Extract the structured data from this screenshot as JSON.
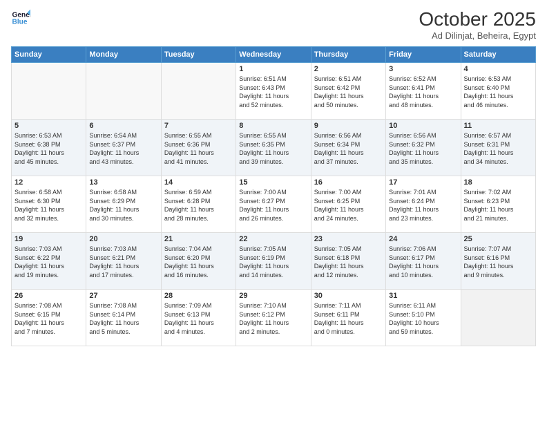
{
  "header": {
    "logo_line1": "General",
    "logo_line2": "Blue",
    "title": "October 2025",
    "location": "Ad Dilinjat, Beheira, Egypt"
  },
  "days_of_week": [
    "Sunday",
    "Monday",
    "Tuesday",
    "Wednesday",
    "Thursday",
    "Friday",
    "Saturday"
  ],
  "weeks": [
    [
      {
        "day": "",
        "content": ""
      },
      {
        "day": "",
        "content": ""
      },
      {
        "day": "",
        "content": ""
      },
      {
        "day": "1",
        "content": "Sunrise: 6:51 AM\nSunset: 6:43 PM\nDaylight: 11 hours\nand 52 minutes."
      },
      {
        "day": "2",
        "content": "Sunrise: 6:51 AM\nSunset: 6:42 PM\nDaylight: 11 hours\nand 50 minutes."
      },
      {
        "day": "3",
        "content": "Sunrise: 6:52 AM\nSunset: 6:41 PM\nDaylight: 11 hours\nand 48 minutes."
      },
      {
        "day": "4",
        "content": "Sunrise: 6:53 AM\nSunset: 6:40 PM\nDaylight: 11 hours\nand 46 minutes."
      }
    ],
    [
      {
        "day": "5",
        "content": "Sunrise: 6:53 AM\nSunset: 6:38 PM\nDaylight: 11 hours\nand 45 minutes."
      },
      {
        "day": "6",
        "content": "Sunrise: 6:54 AM\nSunset: 6:37 PM\nDaylight: 11 hours\nand 43 minutes."
      },
      {
        "day": "7",
        "content": "Sunrise: 6:55 AM\nSunset: 6:36 PM\nDaylight: 11 hours\nand 41 minutes."
      },
      {
        "day": "8",
        "content": "Sunrise: 6:55 AM\nSunset: 6:35 PM\nDaylight: 11 hours\nand 39 minutes."
      },
      {
        "day": "9",
        "content": "Sunrise: 6:56 AM\nSunset: 6:34 PM\nDaylight: 11 hours\nand 37 minutes."
      },
      {
        "day": "10",
        "content": "Sunrise: 6:56 AM\nSunset: 6:32 PM\nDaylight: 11 hours\nand 35 minutes."
      },
      {
        "day": "11",
        "content": "Sunrise: 6:57 AM\nSunset: 6:31 PM\nDaylight: 11 hours\nand 34 minutes."
      }
    ],
    [
      {
        "day": "12",
        "content": "Sunrise: 6:58 AM\nSunset: 6:30 PM\nDaylight: 11 hours\nand 32 minutes."
      },
      {
        "day": "13",
        "content": "Sunrise: 6:58 AM\nSunset: 6:29 PM\nDaylight: 11 hours\nand 30 minutes."
      },
      {
        "day": "14",
        "content": "Sunrise: 6:59 AM\nSunset: 6:28 PM\nDaylight: 11 hours\nand 28 minutes."
      },
      {
        "day": "15",
        "content": "Sunrise: 7:00 AM\nSunset: 6:27 PM\nDaylight: 11 hours\nand 26 minutes."
      },
      {
        "day": "16",
        "content": "Sunrise: 7:00 AM\nSunset: 6:25 PM\nDaylight: 11 hours\nand 24 minutes."
      },
      {
        "day": "17",
        "content": "Sunrise: 7:01 AM\nSunset: 6:24 PM\nDaylight: 11 hours\nand 23 minutes."
      },
      {
        "day": "18",
        "content": "Sunrise: 7:02 AM\nSunset: 6:23 PM\nDaylight: 11 hours\nand 21 minutes."
      }
    ],
    [
      {
        "day": "19",
        "content": "Sunrise: 7:03 AM\nSunset: 6:22 PM\nDaylight: 11 hours\nand 19 minutes."
      },
      {
        "day": "20",
        "content": "Sunrise: 7:03 AM\nSunset: 6:21 PM\nDaylight: 11 hours\nand 17 minutes."
      },
      {
        "day": "21",
        "content": "Sunrise: 7:04 AM\nSunset: 6:20 PM\nDaylight: 11 hours\nand 16 minutes."
      },
      {
        "day": "22",
        "content": "Sunrise: 7:05 AM\nSunset: 6:19 PM\nDaylight: 11 hours\nand 14 minutes."
      },
      {
        "day": "23",
        "content": "Sunrise: 7:05 AM\nSunset: 6:18 PM\nDaylight: 11 hours\nand 12 minutes."
      },
      {
        "day": "24",
        "content": "Sunrise: 7:06 AM\nSunset: 6:17 PM\nDaylight: 11 hours\nand 10 minutes."
      },
      {
        "day": "25",
        "content": "Sunrise: 7:07 AM\nSunset: 6:16 PM\nDaylight: 11 hours\nand 9 minutes."
      }
    ],
    [
      {
        "day": "26",
        "content": "Sunrise: 7:08 AM\nSunset: 6:15 PM\nDaylight: 11 hours\nand 7 minutes."
      },
      {
        "day": "27",
        "content": "Sunrise: 7:08 AM\nSunset: 6:14 PM\nDaylight: 11 hours\nand 5 minutes."
      },
      {
        "day": "28",
        "content": "Sunrise: 7:09 AM\nSunset: 6:13 PM\nDaylight: 11 hours\nand 4 minutes."
      },
      {
        "day": "29",
        "content": "Sunrise: 7:10 AM\nSunset: 6:12 PM\nDaylight: 11 hours\nand 2 minutes."
      },
      {
        "day": "30",
        "content": "Sunrise: 7:11 AM\nSunset: 6:11 PM\nDaylight: 11 hours\nand 0 minutes."
      },
      {
        "day": "31",
        "content": "Sunrise: 6:11 AM\nSunset: 5:10 PM\nDaylight: 10 hours\nand 59 minutes."
      },
      {
        "day": "",
        "content": ""
      }
    ]
  ]
}
